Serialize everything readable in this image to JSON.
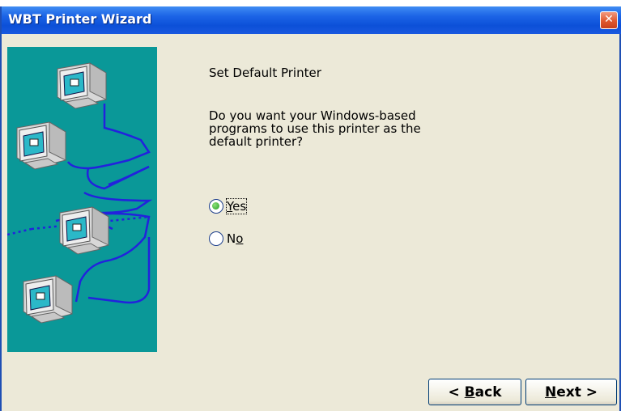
{
  "window": {
    "title": "WBT Printer Wizard",
    "close_glyph": "✕"
  },
  "page": {
    "heading": "Set Default Printer",
    "question_lines": [
      "Do you want your Windows-based",
      "programs to use this printer as the",
      "default printer?"
    ]
  },
  "options": [
    {
      "label_access": "Y",
      "label_rest": "es",
      "selected": true
    },
    {
      "label_access": "N",
      "label_rest": "o",
      "selected": false
    }
  ],
  "buttons": {
    "back": {
      "prefix": "< ",
      "access": "B",
      "rest": "ack"
    },
    "next": {
      "prefix": "",
      "access": "N",
      "rest": "ext >"
    }
  },
  "colors": {
    "side_panel": "#0a9898",
    "network_line": "#2222dd",
    "titlebar": "#0c50d8"
  },
  "icons": {
    "side_art": "networked-computers-illustration",
    "close": "close-icon"
  }
}
